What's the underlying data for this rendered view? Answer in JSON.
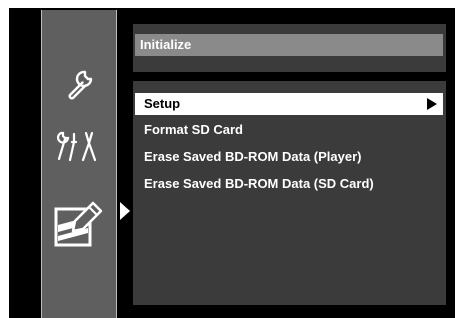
{
  "sidebar": {
    "icons": [
      {
        "name": "wrench-icon",
        "selected": false
      },
      {
        "name": "tools-icon",
        "selected": false
      },
      {
        "name": "initialize-icon",
        "selected": true
      }
    ]
  },
  "header": {
    "title": "Initialize"
  },
  "menu": {
    "items": [
      {
        "label": "Setup",
        "selected": true,
        "has_submenu": true
      },
      {
        "label": "Format SD Card",
        "selected": false
      },
      {
        "label": "Erase Saved BD-ROM Data (Player)",
        "selected": false
      },
      {
        "label": "Erase Saved BD-ROM Data (SD Card)",
        "selected": false
      }
    ]
  },
  "colors": {
    "background": "#000000",
    "sidebar": "#5f5f5f",
    "panel": "#3b3b3b",
    "title_bar": "#8a8a8a",
    "highlight": "#ffffff",
    "text": "#ffffff"
  }
}
